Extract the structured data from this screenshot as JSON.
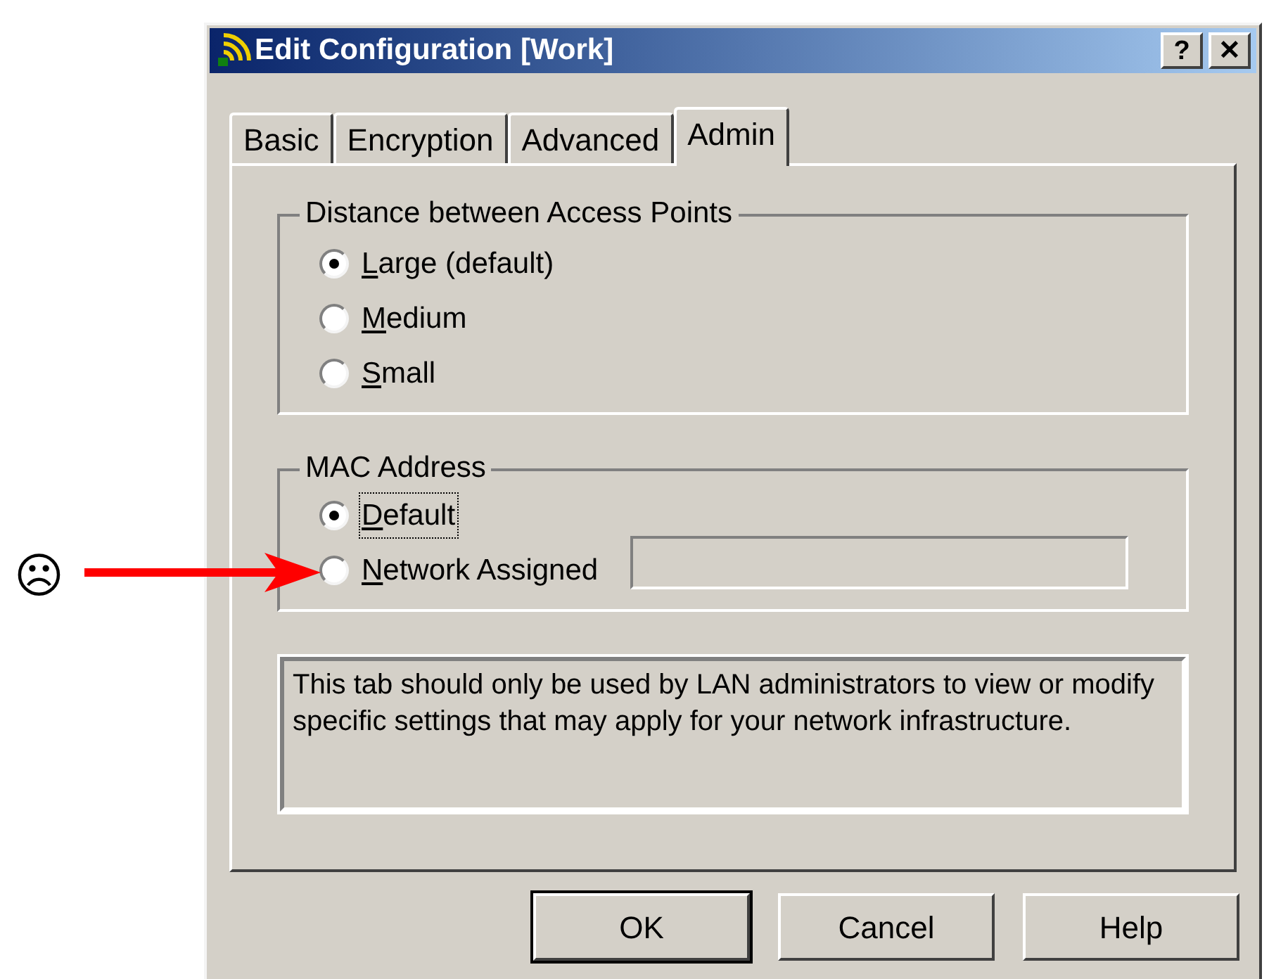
{
  "annotation": {
    "symbol": "☹"
  },
  "window": {
    "title": "Edit Configuration [Work]",
    "title_buttons": [
      "?",
      "✕"
    ]
  },
  "tabs": [
    {
      "label": "Basic",
      "selected": false
    },
    {
      "label": "Encryption",
      "selected": false
    },
    {
      "label": "Advanced",
      "selected": false
    },
    {
      "label": "Admin",
      "selected": true
    }
  ],
  "distance_group": {
    "title": "Distance between Access Points",
    "options": [
      {
        "label": "Large (default)",
        "selected": true
      },
      {
        "label": "Medium",
        "selected": false
      },
      {
        "label": "Small",
        "selected": false
      }
    ]
  },
  "mac_group": {
    "title": "MAC Address",
    "options": [
      {
        "label": "Default",
        "selected": true,
        "focused": true
      },
      {
        "label": "Network Assigned",
        "selected": false,
        "focused": false
      }
    ],
    "address_field": {
      "disabled": true
    }
  },
  "info_text": "This tab should only be used by LAN administrators to view or modify specific settings that may apply for your network infrastructure.",
  "buttons": [
    {
      "label": "OK",
      "default": true
    },
    {
      "label": "Cancel",
      "default": false
    },
    {
      "label": "Help",
      "default": false
    }
  ]
}
